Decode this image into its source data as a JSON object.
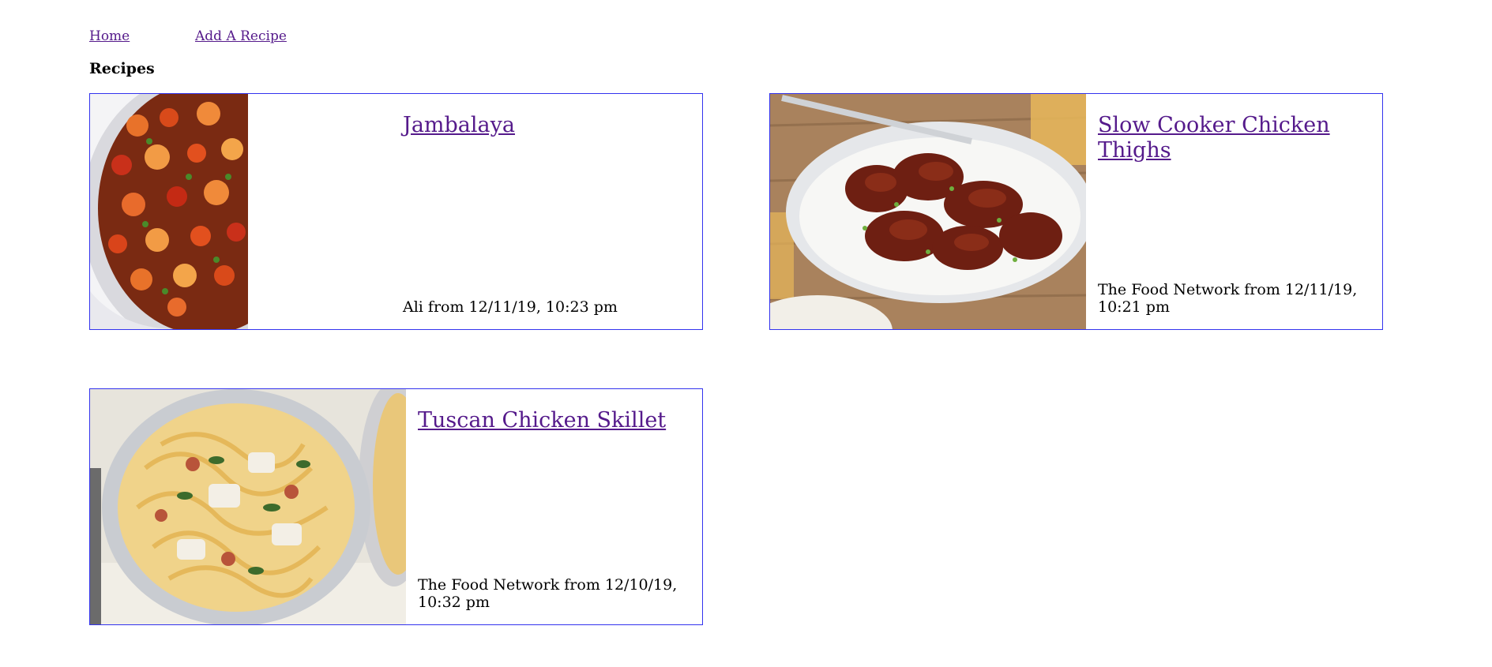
{
  "nav": {
    "home": "Home",
    "add_recipe": "Add A Recipe"
  },
  "heading": "Recipes",
  "recipes": [
    {
      "title": "Jambalaya",
      "meta": "Ali from 12/11/19, 10:23 pm",
      "image_subject": "jambalaya-pot-photo"
    },
    {
      "title": "Slow Cooker Chicken Thighs",
      "meta": "The Food Network from 12/11/19, 10:21 pm",
      "image_subject": "chicken-thighs-rice-photo"
    },
    {
      "title": "Tuscan Chicken Skillet",
      "meta": "The Food Network from 12/10/19, 10:32 pm",
      "image_subject": "pasta-bowl-photo"
    }
  ],
  "colors": {
    "link": "#551a8b",
    "card_border": "#3333ee"
  }
}
